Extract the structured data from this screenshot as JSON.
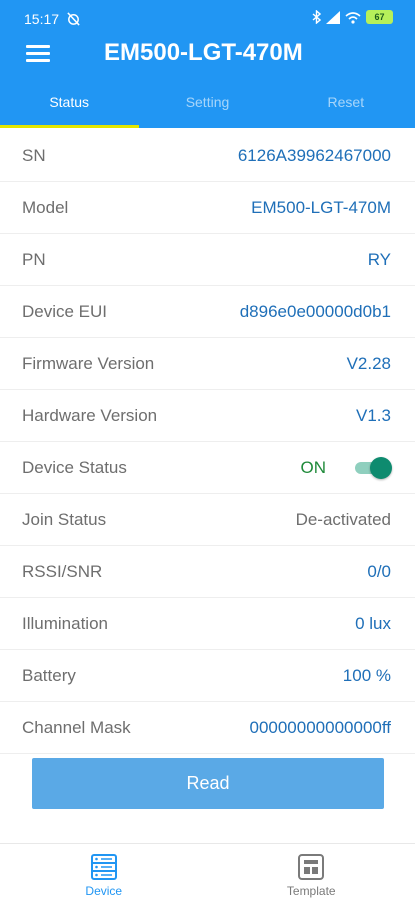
{
  "status_bar": {
    "time": "15:17",
    "battery": "67"
  },
  "header": {
    "title": "EM500-LGT-470M"
  },
  "tabs": [
    {
      "label": "Status"
    },
    {
      "label": "Setting"
    },
    {
      "label": "Reset"
    }
  ],
  "rows": [
    {
      "label": "SN",
      "value": "6126A39962467000"
    },
    {
      "label": "Model",
      "value": "EM500-LGT-470M"
    },
    {
      "label": "PN",
      "value": "RY"
    },
    {
      "label": "Device EUI",
      "value": "d896e0e00000d0b1"
    },
    {
      "label": "Firmware Version",
      "value": "V2.28"
    },
    {
      "label": "Hardware Version",
      "value": "V1.3"
    },
    {
      "label": "Device Status",
      "value": "ON",
      "toggle_on": true
    },
    {
      "label": "Join Status",
      "value": "De-activated"
    },
    {
      "label": "RSSI/SNR",
      "value": "0/0"
    },
    {
      "label": "Illumination",
      "value": "0 lux"
    },
    {
      "label": "Battery",
      "value": "100 %"
    },
    {
      "label": "Channel Mask",
      "value": "00000000000000ff"
    }
  ],
  "read_button": {
    "label": "Read"
  },
  "bottom_nav": [
    {
      "label": "Device",
      "icon": "server-icon"
    },
    {
      "label": "Template",
      "icon": "template-icon"
    }
  ],
  "colors": {
    "accent": "#2196f3",
    "tab_indicator": "#e3e600",
    "value_blue": "#1f6fb8",
    "on_green": "#1f8a3a",
    "toggle_teal": "#0e8b6f",
    "read_button": "#5aa9e6"
  }
}
